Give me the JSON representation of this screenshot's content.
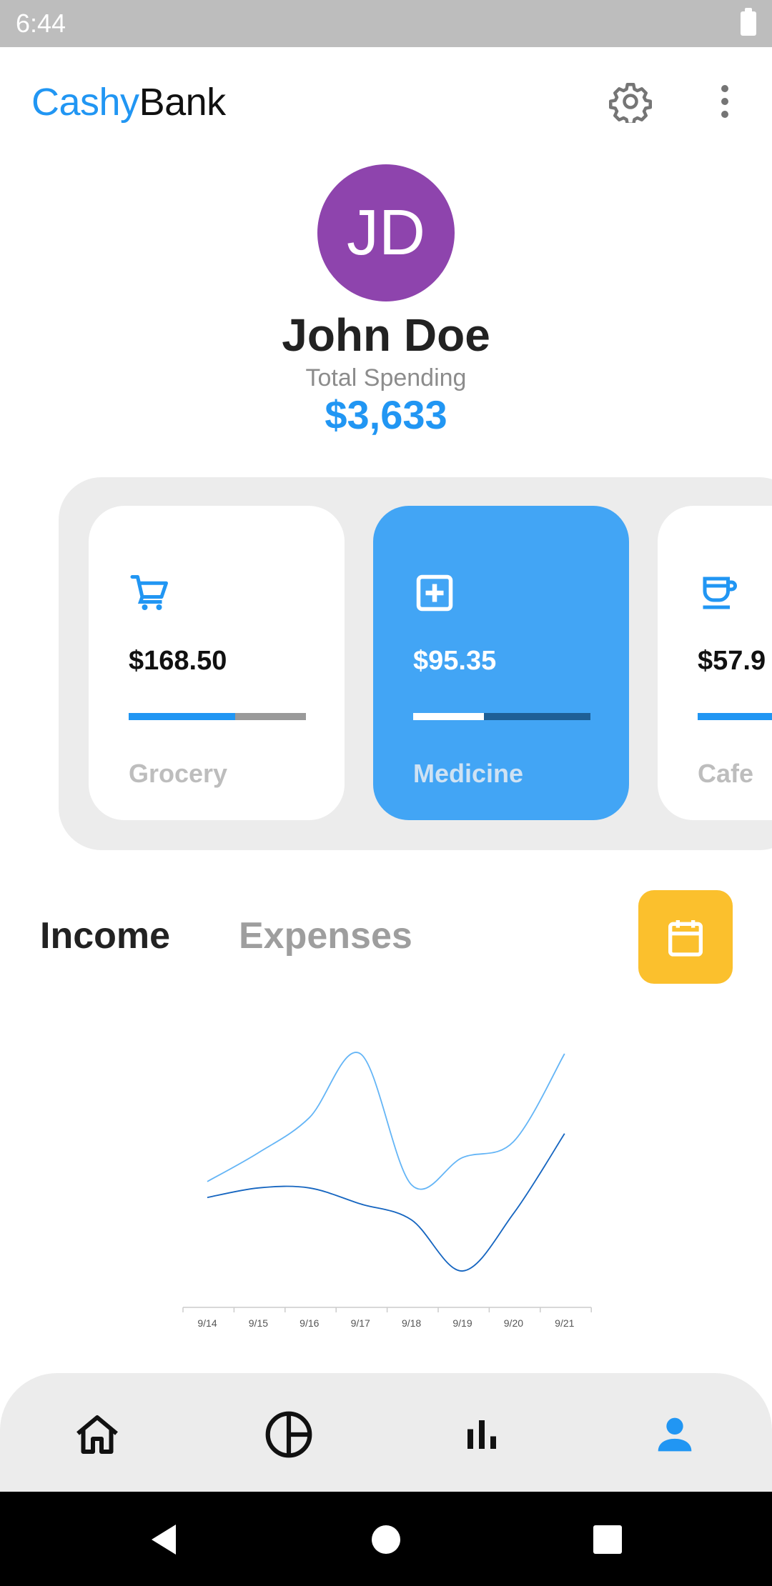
{
  "status_bar": {
    "time": "6:44"
  },
  "app_bar": {
    "brand_part1": "Cashy",
    "brand_part2": "Bank"
  },
  "profile": {
    "initials": "JD",
    "avatar_color": "#8e44ad",
    "name": "John Doe",
    "spending_label": "Total Spending",
    "spending_value": "$3,633"
  },
  "categories": [
    {
      "label": "Grocery",
      "amount": "$168.50",
      "icon": "cart-icon",
      "progress": 0.6,
      "active": false
    },
    {
      "label": "Medicine",
      "amount": "$95.35",
      "icon": "medical-cross-icon",
      "progress": 0.4,
      "active": true
    },
    {
      "label": "Cafe",
      "amount": "$57.9",
      "icon": "coffee-cup-icon",
      "progress": 0.45,
      "active": false
    }
  ],
  "tabs": {
    "income": "Income",
    "expenses": "Expenses",
    "active": "Income"
  },
  "calendar": {
    "icon": "calendar-icon",
    "color": "#fbc02d"
  },
  "chart_data": {
    "type": "line",
    "categories": [
      "9/14",
      "9/15",
      "9/16",
      "9/17",
      "9/18",
      "9/19",
      "9/20",
      "9/21"
    ],
    "series": [
      {
        "values": [
          0.2,
          0.38,
          0.6,
          1.0,
          0.18,
          0.35,
          0.45,
          1.0
        ],
        "color": "#64b5f6"
      },
      {
        "values": [
          0.1,
          0.16,
          0.16,
          0.06,
          -0.04,
          -0.36,
          0.0,
          0.5
        ],
        "color": "#1565c0"
      }
    ]
  },
  "bottom_nav": [
    {
      "icon": "home-icon",
      "active": false
    },
    {
      "icon": "pie-chart-icon",
      "active": false
    },
    {
      "icon": "bar-chart-icon",
      "active": false
    },
    {
      "icon": "profile-icon",
      "active": true
    }
  ],
  "colors": {
    "accent": "#2196f3",
    "active_card": "#42a5f5"
  }
}
